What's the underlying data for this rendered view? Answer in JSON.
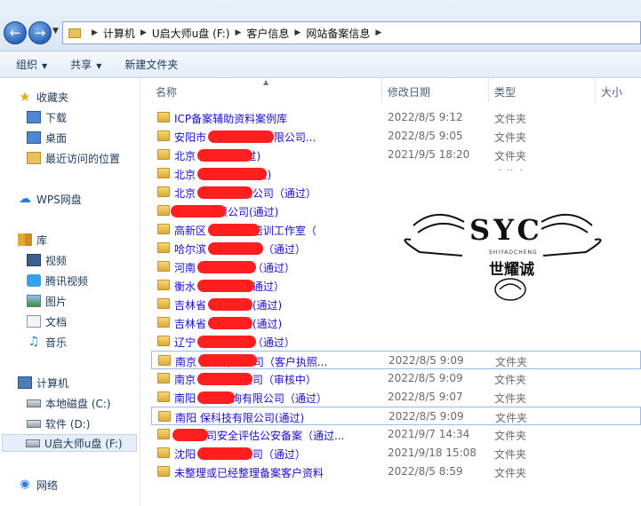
{
  "address_bar": {
    "crumbs": [
      "计算机",
      "U启大师u盘 (F:)",
      "客户信息",
      "网站备案信息"
    ]
  },
  "toolbar": {
    "organize": "组织",
    "share": "共享",
    "new_folder": "新建文件夹"
  },
  "nav": {
    "favorites": "收藏夹",
    "downloads": "下载",
    "desktop": "桌面",
    "recent": "最近访问的位置",
    "wps": "WPS网盘",
    "libraries": "库",
    "videos": "视频",
    "tencent_video": "腾讯视频",
    "pictures": "图片",
    "documents": "文档",
    "music": "音乐",
    "computer": "计算机",
    "local_disk": "本地磁盘 (C:)",
    "soft_disk": "软件 (D:)",
    "usb_disk": "U启大师u盘 (F:)",
    "network": "网络"
  },
  "columns": {
    "name": "名称",
    "modified": "修改日期",
    "type": "类型",
    "size": "大小"
  },
  "files": [
    {
      "name": "ICP备案辅助资料案例库",
      "date": "2022/8/5 9:12",
      "type": "文件夹"
    },
    {
      "name": "安阳市                       理咨询服务有限公司...",
      "date": "2022/8/5 9:05",
      "type": "文件夹"
    },
    {
      "name": "北京                     限公司(通过)",
      "date": "2021/9/5 18:20",
      "type": "文件夹"
    },
    {
      "name": "北京                       有限公司(通过)",
      "date": "",
      "type": "文件夹"
    },
    {
      "name": "北京                     化发展有限公司（通过）",
      "date": "",
      "type": ""
    },
    {
      "name": "                       络科技有限公司(通过)",
      "date": "",
      "type": ""
    },
    {
      "name": "高新区                  文化艺术培训工作室（",
      "date": "",
      "type": ""
    },
    {
      "name": "哈尔滨                   术服务中心（通过）",
      "date": "",
      "type": ""
    },
    {
      "name": "河南                      技有限公司（通过）",
      "date": "",
      "type": ""
    },
    {
      "name": "衡水                      有限公司（通过）",
      "date": "",
      "type": ""
    },
    {
      "name": "吉林省                  有限公司(通过)",
      "date": "",
      "type": ""
    },
    {
      "name": "吉林省                  有限公司(通过)",
      "date": "",
      "type": ""
    },
    {
      "name": "辽宁                       技有限公司（通过）",
      "date": "",
      "type": ""
    },
    {
      "name": "南京                        技术有限公司（客户执照...",
      "date": "2022/8/5 9:09",
      "type": "文件夹"
    },
    {
      "name": "南京                      科技有限公司（审核中）",
      "date": "2022/8/5 9:09",
      "type": "文件夹"
    },
    {
      "name": "南阳                  信息咨询有限公司（通过）",
      "date": "2022/8/5 9:07",
      "type": "文件夹"
    },
    {
      "name": "南阳                  保科技有限公司(通过)",
      "date": "2022/8/5 9:09",
      "type": "文件夹"
    },
    {
      "name": "                    科技公司安全评估公安备案（通过...",
      "date": "2021/9/7 14:34",
      "type": "文件夹"
    },
    {
      "name": "沈阳                     科技有限公司（通过）",
      "date": "2021/9/18 15:08",
      "type": "文件夹"
    },
    {
      "name": "未整理或已经整理备案客户资料",
      "date": "2022/8/5 8:59",
      "type": "文件夹"
    }
  ],
  "watermark": {
    "letters": "SYC",
    "pinyin": "SHIYAOCHENG",
    "chinese": "世耀诚"
  }
}
